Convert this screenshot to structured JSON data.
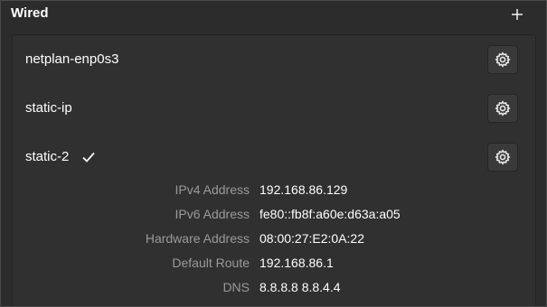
{
  "section": {
    "title": "Wired",
    "add_icon": "plus-icon"
  },
  "connections": [
    {
      "label": "netplan-enp0s3",
      "active": false,
      "settings_icon": "gear-icon"
    },
    {
      "label": "static-ip",
      "active": false,
      "settings_icon": "gear-icon"
    },
    {
      "label": "static-2",
      "active": true,
      "settings_icon": "gear-icon"
    }
  ],
  "details": [
    {
      "key": "IPv4 Address",
      "value": "192.168.86.129"
    },
    {
      "key": "IPv6 Address",
      "value": "fe80::fb8f:a60e:d63a:a05"
    },
    {
      "key": "Hardware Address",
      "value": "08:00:27:E2:0A:22"
    },
    {
      "key": "Default Route",
      "value": "192.168.86.1"
    },
    {
      "key": "DNS",
      "value": "8.8.8.8 8.8.4.4"
    }
  ],
  "colors": {
    "background": "#2c2c2c",
    "card": "#303030",
    "label_muted": "#9a9a9a",
    "text": "#ffffff"
  }
}
